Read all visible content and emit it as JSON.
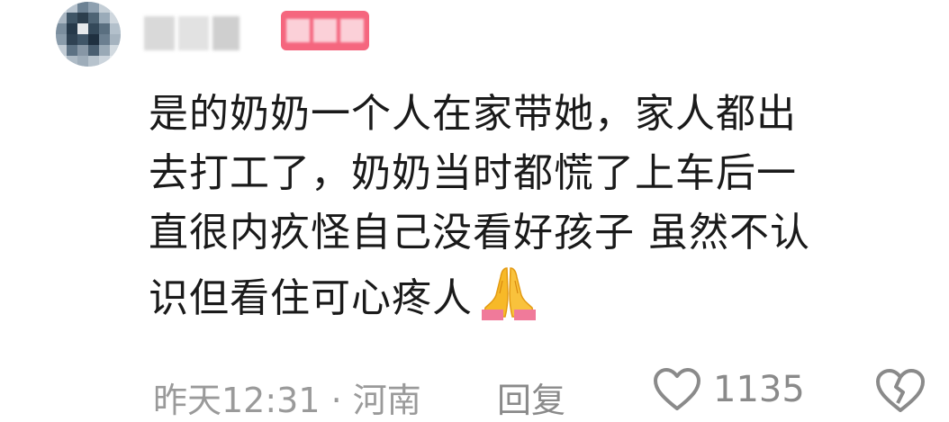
{
  "comment": {
    "lines": [
      "是的奶奶一个人在家带她，家人都出",
      "去打工了，奶奶当时都慌了上车后一",
      "直很内疚怪自己没看好孩子 虽然不认",
      "识但看住可心疼人"
    ],
    "emoji": "folded-hands-icon"
  },
  "footer": {
    "meta": "昨天12:31 · 河南",
    "reply_label": "回复",
    "like_count": "1135"
  },
  "colors": {
    "text": "#1a1a1a",
    "muted": "#9a9a9a",
    "badge": "#f5667e"
  }
}
